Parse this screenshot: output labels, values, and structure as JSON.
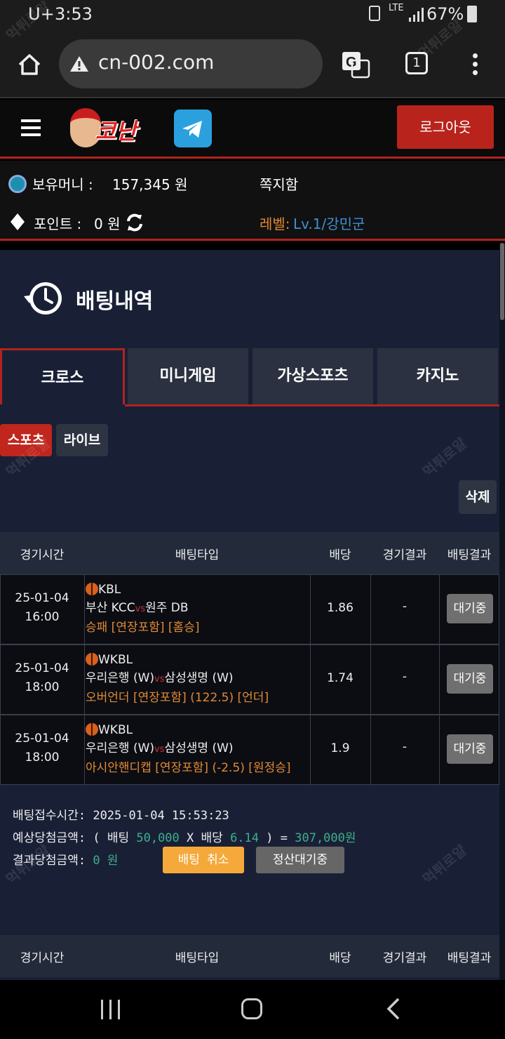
{
  "status_bar": {
    "carrier": "U+",
    "time": "3:53",
    "network": "LTE",
    "battery": "67%"
  },
  "browser": {
    "url": "cn-002.com",
    "tab_count": "1"
  },
  "header": {
    "logo_text": "코난",
    "logout_label": "로그아웃"
  },
  "info": {
    "money_label": "보유머니 :",
    "money_value": "157,345 원",
    "message_label": "쪽지함",
    "point_label": "포인트 :",
    "point_value": "0 원",
    "level_label": "레벨:",
    "level_value": "Lv.1/강민군"
  },
  "page": {
    "title": "배팅내역"
  },
  "tabs": [
    {
      "label": "크로스",
      "active": true
    },
    {
      "label": "미니게임",
      "active": false
    },
    {
      "label": "가상스포츠",
      "active": false
    },
    {
      "label": "카지노",
      "active": false
    }
  ],
  "subtabs": [
    {
      "label": "스포츠",
      "active": true
    },
    {
      "label": "라이브",
      "active": false
    }
  ],
  "delete_label": "삭제",
  "table": {
    "headers": [
      "경기시간",
      "배팅타입",
      "배당",
      "경기결과",
      "배팅결과"
    ],
    "rows": [
      {
        "date": "25-01-04",
        "time": "16:00",
        "league": "KBL",
        "home": "부산 KCC",
        "vs": "vs",
        "away": "원주 DB",
        "bet_type": "승패 [연장포함] [홈승]",
        "odds": "1.86",
        "result": "-",
        "status": "대기중"
      },
      {
        "date": "25-01-04",
        "time": "18:00",
        "league": "WKBL",
        "home": "우리은행 (W)",
        "vs": "vs",
        "away": "삼성생명 (W)",
        "bet_type": "오버언더 [연장포함] (122.5) [언더]",
        "odds": "1.74",
        "result": "-",
        "status": "대기중"
      },
      {
        "date": "25-01-04",
        "time": "18:00",
        "league": "WKBL",
        "home": "우리은행 (W)",
        "vs": "vs",
        "away": "삼성생명 (W)",
        "bet_type": "아시안핸디캡 [연장포함] (-2.5) [원정승]",
        "odds": "1.9",
        "result": "-",
        "status": "대기중"
      }
    ]
  },
  "summary": {
    "receipt_label": "배팅접수시간:",
    "receipt_time": "2025-01-04 15:53:23",
    "expected_label": "예상당첨금액:",
    "open_paren": "(",
    "bet_label": "배팅",
    "bet_amount": "50,000",
    "times": "X",
    "odds_label": "배당",
    "total_odds": "6.14",
    "close_eq": ") =",
    "expected_amount": "307,000원",
    "result_label": "결과당첨금액:",
    "result_amount": "0 원",
    "cancel_label": "배팅 취소",
    "pending_label": "정산대기중"
  },
  "table2": {
    "headers": [
      "경기시간",
      "배팅타입",
      "배당",
      "경기결과",
      "배팅결과"
    ]
  },
  "watermark": "먹튀로얄",
  "colors": {
    "accent": "#b3231c",
    "orange": "#e08a35",
    "teal": "#3fae8c",
    "level_blue": "#3f8fd6"
  }
}
